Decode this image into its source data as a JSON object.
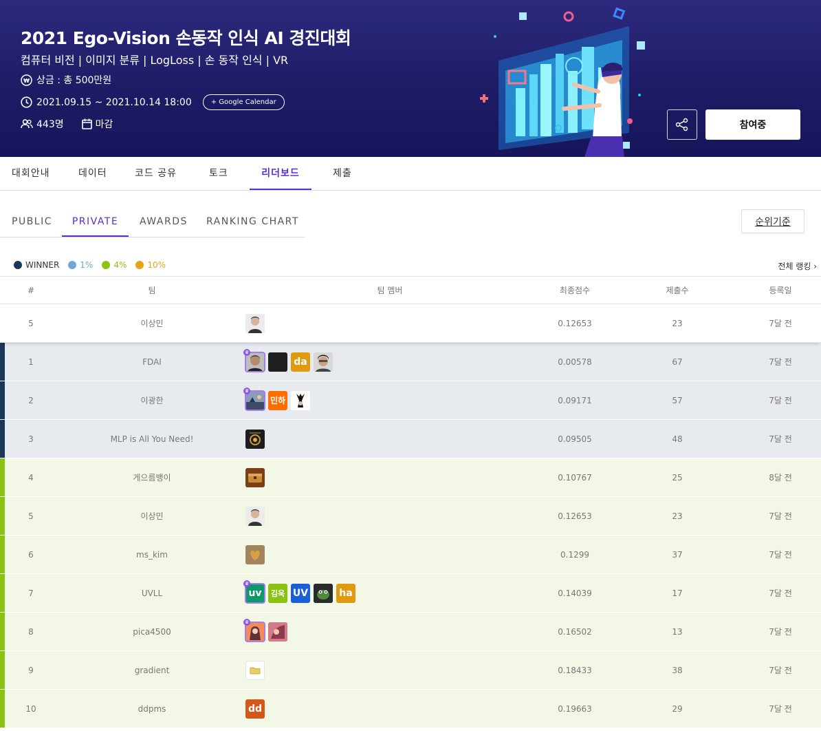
{
  "banner": {
    "title": "2021 Ego-Vision 손동작 인식 AI 경진대회",
    "tags": "컴퓨터 비전 | 이미지 분류 | LogLoss | 손 동작 인식 | VR",
    "prize": "상금 : 총 500만원",
    "period": "2021.09.15 ~ 2021.10.14 18:00",
    "gcal_label": "+ Google Calendar",
    "participants": "443명",
    "status": "마감",
    "join_label": "참여중"
  },
  "main_tabs": [
    {
      "label": "대회안내"
    },
    {
      "label": "데이터"
    },
    {
      "label": "코드 공유"
    },
    {
      "label": "토크"
    },
    {
      "label": "리더보드"
    },
    {
      "label": "제출"
    }
  ],
  "sub_tabs": [
    {
      "label": "PUBLIC"
    },
    {
      "label": "PRIVATE"
    },
    {
      "label": "AWARDS"
    },
    {
      "label": "RANKING CHART"
    }
  ],
  "rank_basis_label": "순위기준",
  "legend": [
    {
      "label": "WINNER",
      "color": "#1a3658"
    },
    {
      "label": "1%",
      "color": "#6fa8d6"
    },
    {
      "label": "4%",
      "color": "#8ac311"
    },
    {
      "label": "10%",
      "color": "#e8a317"
    }
  ],
  "all_ranking_label": "전체 랭킹 ›",
  "table": {
    "headers": {
      "rank": "#",
      "team": "팀",
      "members": "팀 멤버",
      "score": "최종점수",
      "count": "제출수",
      "date": "등록일"
    },
    "my_row": {
      "rank": "5",
      "team": "이상민",
      "score": "0.12653",
      "count": "23",
      "date": "7달 전"
    },
    "rows": [
      {
        "rank": "1",
        "team": "FDAI",
        "score": "0.00578",
        "count": "67",
        "date": "7달 전"
      },
      {
        "rank": "2",
        "team": "이광한",
        "score": "0.09171",
        "count": "57",
        "date": "7달 전"
      },
      {
        "rank": "3",
        "team": "MLP is All You Need!",
        "score": "0.09505",
        "count": "48",
        "date": "7달 전"
      },
      {
        "rank": "4",
        "team": "게으름뱅이",
        "score": "0.10767",
        "count": "25",
        "date": "8달 전"
      },
      {
        "rank": "5",
        "team": "이상민",
        "score": "0.12653",
        "count": "23",
        "date": "7달 전"
      },
      {
        "rank": "6",
        "team": "ms_kim",
        "score": "0.1299",
        "count": "37",
        "date": "7달 전"
      },
      {
        "rank": "7",
        "team": "UVLL",
        "score": "0.14039",
        "count": "17",
        "date": "7달 전"
      },
      {
        "rank": "8",
        "team": "pica4500",
        "score": "0.16502",
        "count": "13",
        "date": "7달 전"
      },
      {
        "rank": "9",
        "team": "gradient",
        "score": "0.18433",
        "count": "38",
        "date": "7달 전"
      },
      {
        "rank": "10",
        "team": "ddpms",
        "score": "0.19663",
        "count": "29",
        "date": "7달 전"
      }
    ],
    "text_avatars": {
      "fdai_3": "da",
      "lee_2": "민하",
      "uvll_1": "uv",
      "uvll_2": "김욱",
      "uvll_3": "UV",
      "uvll_5": "ha",
      "ddpms_1": "dd"
    }
  }
}
